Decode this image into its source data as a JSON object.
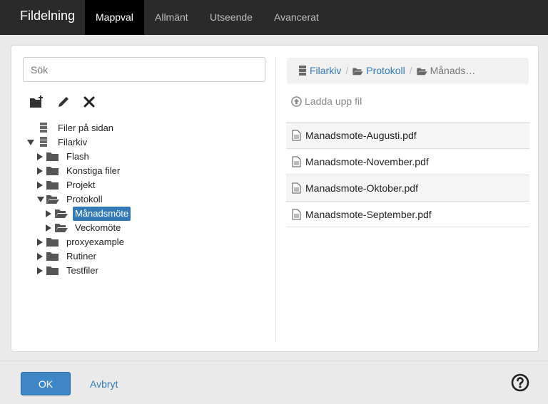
{
  "header": {
    "title": "Fildelning",
    "tabs": [
      "Mappval",
      "Allmänt",
      "Utseende",
      "Avancerat"
    ]
  },
  "search": {
    "placeholder": "Sök"
  },
  "toolbar": {
    "icons": [
      "new-folder-icon",
      "pencil-icon",
      "delete-icon"
    ]
  },
  "tree": {
    "roots": [
      {
        "label": "Filer på sidan"
      },
      {
        "label": "Filarkiv"
      }
    ],
    "folders": [
      {
        "label": "Flash"
      },
      {
        "label": "Konstiga filer"
      },
      {
        "label": "Projekt"
      },
      {
        "label": "Protokoll"
      },
      {
        "label": "Månadsmöte",
        "selected": true
      },
      {
        "label": "Veckomöte"
      },
      {
        "label": "proxyexample"
      },
      {
        "label": "Rutiner"
      },
      {
        "label": "Testfiler"
      }
    ]
  },
  "breadcrumb": {
    "items": [
      "Filarkiv",
      "Protokoll",
      "Månads…"
    ]
  },
  "upload_label": "Ladda upp fil",
  "files": [
    "Manadsmote-Augusti.pdf",
    "Manadsmote-November.pdf",
    "Manadsmote-Oktober.pdf",
    "Manadsmote-September.pdf"
  ],
  "footer": {
    "ok": "OK",
    "cancel": "Avbryt",
    "help_icon": "help-icon"
  },
  "colors": {
    "accent": "#337ab7",
    "topbar": "#2a2a2a",
    "active_tab": "#000000",
    "selected": "#337ab7"
  }
}
